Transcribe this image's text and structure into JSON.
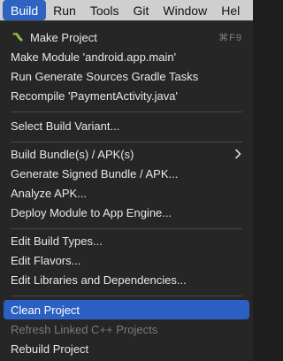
{
  "menubar": {
    "items": [
      "Build",
      "Run",
      "Tools",
      "Git",
      "Window",
      "Hel"
    ]
  },
  "menu": {
    "make_project": {
      "label": "Make Project",
      "shortcut": "⌘F9",
      "icon": "hammer-icon"
    },
    "make_module": "Make Module 'android.app.main'",
    "run_generate_sources": "Run Generate Sources Gradle Tasks",
    "recompile": "Recompile 'PaymentActivity.java'",
    "select_build_variant": "Select Build Variant...",
    "build_bundles": "Build Bundle(s) / APK(s)",
    "generate_signed": "Generate Signed Bundle / APK...",
    "analyze_apk": "Analyze APK...",
    "deploy_module": "Deploy Module to App Engine...",
    "edit_build_types": "Edit Build Types...",
    "edit_flavors": "Edit Flavors...",
    "edit_libraries": "Edit Libraries and Dependencies...",
    "clean_project": "Clean Project",
    "refresh_linked": "Refresh Linked C++ Projects",
    "rebuild_project": "Rebuild Project"
  },
  "colors": {
    "accent": "#2b5fc4",
    "menu_bg": "#262626",
    "menubar_bg": "#cfcfcf",
    "disabled_text": "#7a7a7a"
  }
}
